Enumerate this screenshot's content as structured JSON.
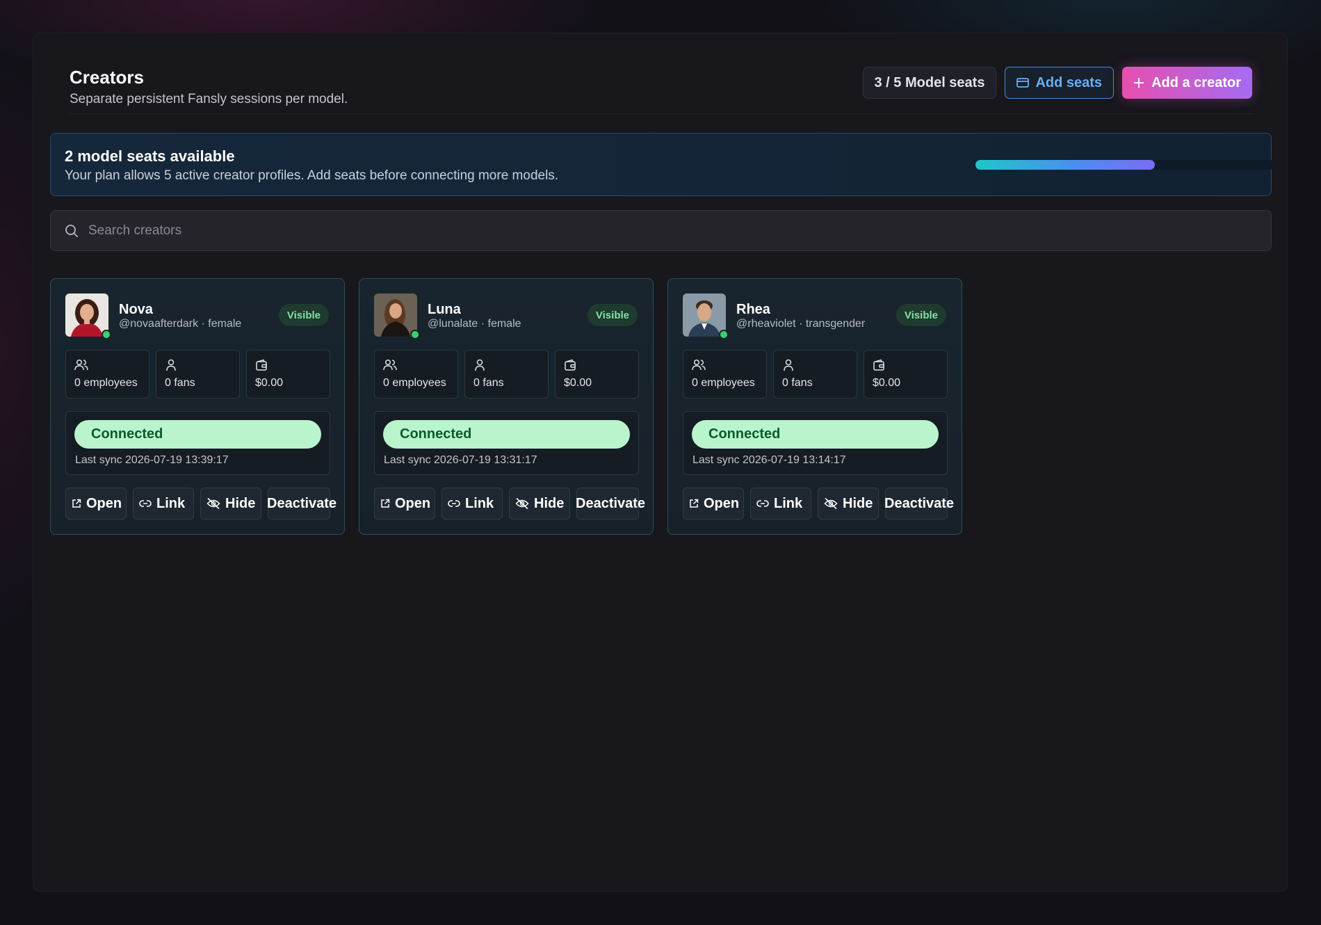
{
  "header": {
    "title": "Creators",
    "subtitle": "Separate persistent Fansly sessions per model.",
    "seat_count": "3 / 5 Model seats",
    "add_seats_label": "Add seats",
    "add_creator_label": "Add a creator"
  },
  "banner": {
    "title": "2 model seats available",
    "text": "Your plan allows 5 active creator profiles. Add seats before connecting more models.",
    "seats_used": 3,
    "seats_total": 5
  },
  "search": {
    "placeholder": "Search creators",
    "value": ""
  },
  "creators": [
    {
      "name": "Nova",
      "handle": "@novaafterdark · female",
      "visibility": "Visible",
      "employees": "0 employees",
      "fans": "0 fans",
      "revenue": "$0.00",
      "status": "Connected",
      "last_sync": "Last sync 2026-07-19 13:39:17",
      "actions": {
        "open": "Open",
        "link": "Link",
        "hide": "Hide",
        "deactivate": "Deactivate"
      }
    },
    {
      "name": "Luna",
      "handle": "@lunalate · female",
      "visibility": "Visible",
      "employees": "0 employees",
      "fans": "0 fans",
      "revenue": "$0.00",
      "status": "Connected",
      "last_sync": "Last sync 2026-07-19 13:31:17",
      "actions": {
        "open": "Open",
        "link": "Link",
        "hide": "Hide",
        "deactivate": "Deactivate"
      }
    },
    {
      "name": "Rhea",
      "handle": "@rheaviolet · transgender",
      "visibility": "Visible",
      "employees": "0 employees",
      "fans": "0 fans",
      "revenue": "$0.00",
      "status": "Connected",
      "last_sync": "Last sync 2026-07-19 13:14:17",
      "actions": {
        "open": "Open",
        "link": "Link",
        "hide": "Hide",
        "deactivate": "Deactivate"
      }
    }
  ],
  "colors": {
    "accent_gradient_start": "#e74fae",
    "accent_gradient_end": "#a56bf3",
    "connected_bg": "#b9f4cc",
    "online_dot": "#3bd16f",
    "link_blue": "#6aaef5"
  }
}
